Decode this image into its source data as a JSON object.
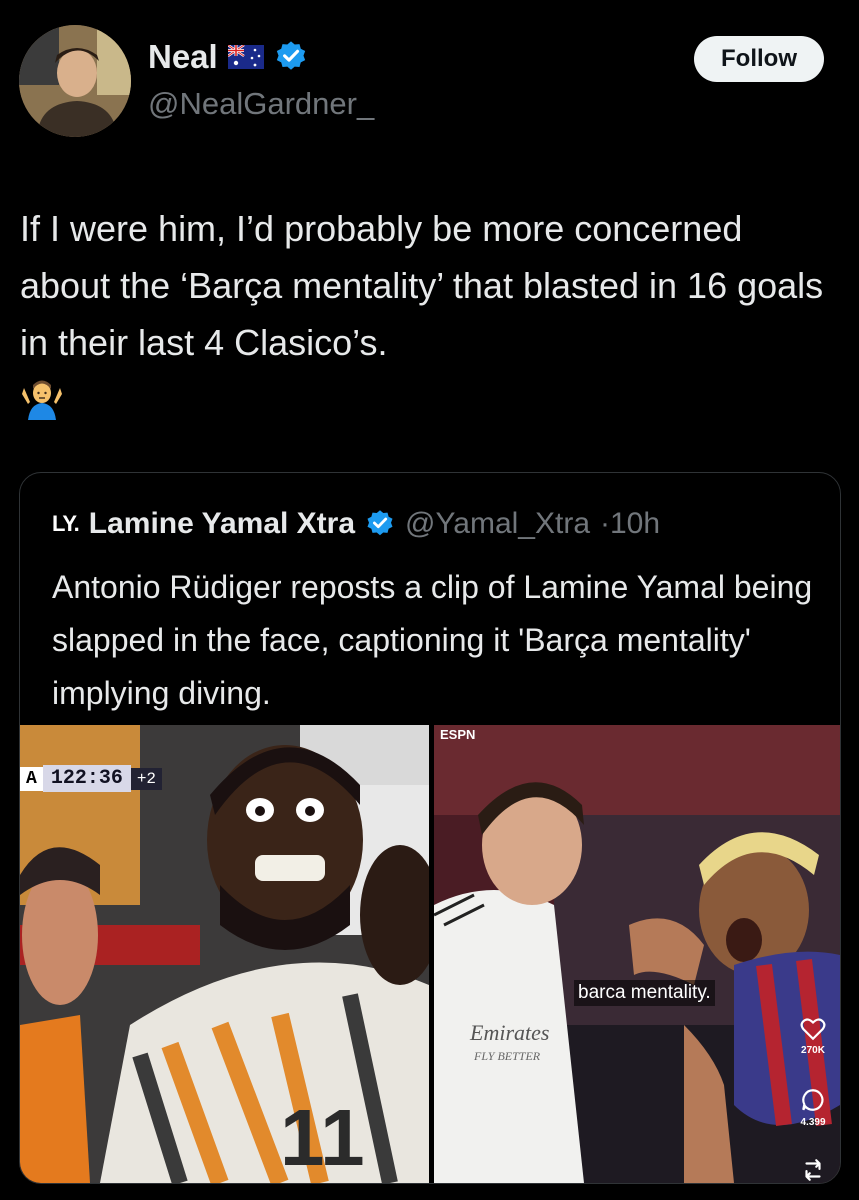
{
  "author": {
    "name": "Neal",
    "handle": "@NealGardner_",
    "follow_label": "Follow"
  },
  "tweet": {
    "text": "If I were him, I’d probably be more concerned about the ‘Barça mentality’ that blasted in 16 goals in their last 4 Clasico’s.",
    "emoji_icon": "person-shrugging-emoji"
  },
  "quoted": {
    "logo": "LY.",
    "name": "Lamine Yamal Xtra",
    "handle": "@Yamal_Xtra",
    "time": "·10h",
    "text": "Antonio Rüdiger reposts a clip of Lamine Yamal being slapped in the face, captioning it 'Barça mentality' implying diving.",
    "media_left": {
      "clock_team": "A",
      "clock_time": "122:36",
      "clock_added": "+2",
      "shirt_number": "11"
    },
    "media_right": {
      "broadcaster": "ESPN",
      "caption": "barca mentality.",
      "sponsor_line1": "Emirates",
      "sponsor_line2": "FLY BETTER",
      "likes": "270K",
      "comments": "4.399"
    }
  },
  "colors": {
    "background": "#000000",
    "text": "#e7e9ea",
    "muted": "#71767b",
    "verified": "#1d9bf0",
    "border": "#2f3336"
  }
}
